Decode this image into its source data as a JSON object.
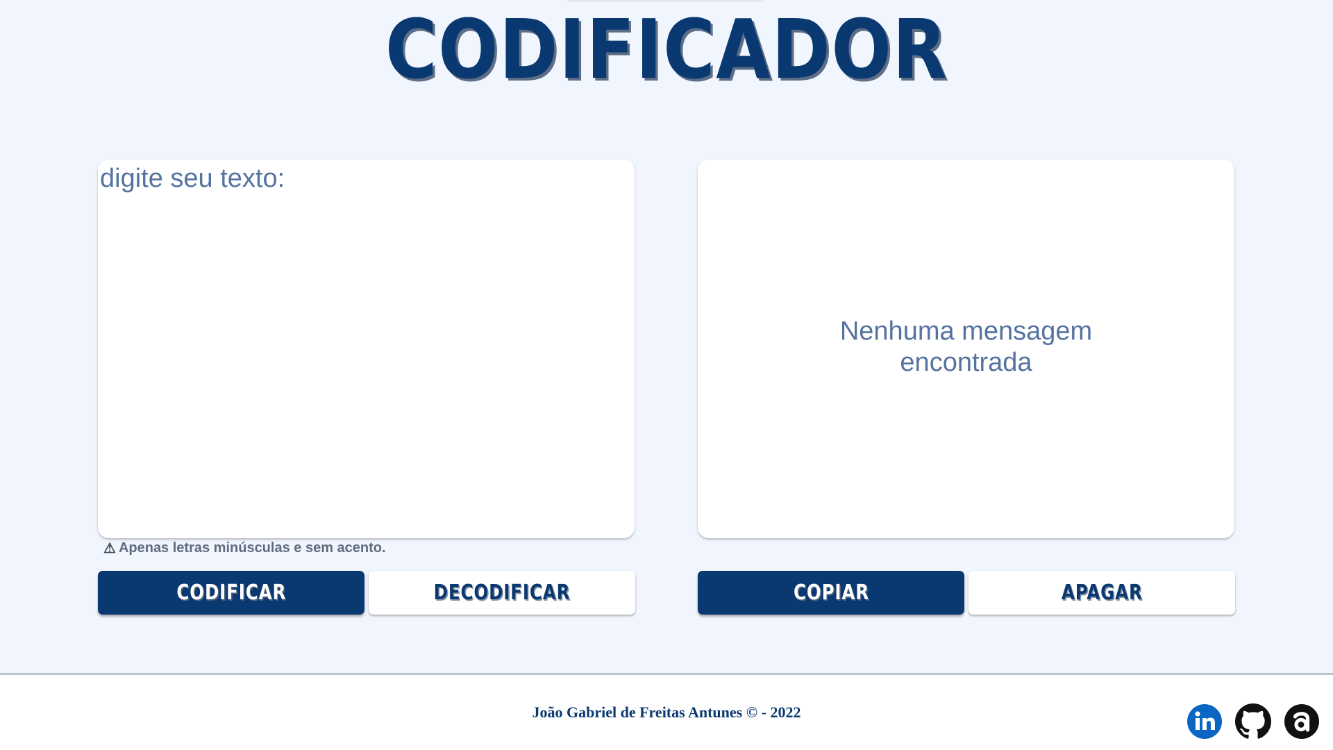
{
  "header": {
    "title": "CODIFICADOR"
  },
  "input_panel": {
    "placeholder": "digite seu texto:",
    "value": ""
  },
  "hint": {
    "icon": "warning-icon",
    "text": "Apenas letras minúsculas e sem acento."
  },
  "output_panel": {
    "empty_line1": "Nenhuma mensagem",
    "empty_line2": "encontrada"
  },
  "buttons": {
    "encrypt": "CODIFICAR",
    "decrypt": "DECODIFICAR",
    "copy": "COPIAR",
    "clear": "APAGAR"
  },
  "footer": {
    "copyright": "João Gabriel de Freitas Antunes © - 2022",
    "social": [
      {
        "name": "linkedin-icon"
      },
      {
        "name": "github-icon"
      },
      {
        "name": "alura-icon"
      }
    ]
  },
  "colors": {
    "background": "#F1F5FD",
    "primary": "#0A3871",
    "muted_text": "#5573A0",
    "hint_text": "#5F6C7D",
    "linkedin": "#0A66C2",
    "github": "#111111"
  }
}
